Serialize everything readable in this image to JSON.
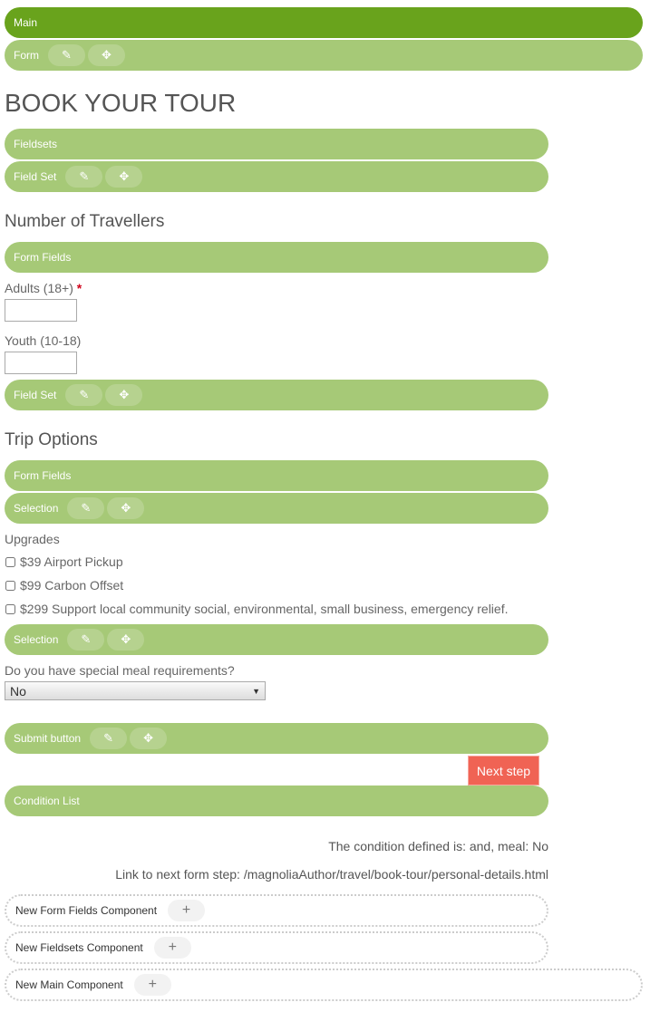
{
  "bars": {
    "main": "Main",
    "form": "Form",
    "fieldsets": "Fieldsets",
    "fieldset1": "Field Set",
    "formfields1": "Form Fields",
    "fieldset2": "Field Set",
    "formfields2": "Form Fields",
    "selection1": "Selection",
    "selection2": "Selection",
    "submit": "Submit button",
    "condition": "Condition List"
  },
  "icons": {
    "edit": "pencil-icon",
    "move": "move-arrows-icon",
    "add": "plus-icon"
  },
  "form": {
    "title": "BOOK YOUR TOUR",
    "travellers_heading": "Number of Travellers",
    "adults_label": "Adults (18+)",
    "required_mark": "*",
    "adults_value": "",
    "youth_label": "Youth (10-18)",
    "youth_value": "",
    "trip_heading": "Trip Options",
    "upgrades_label": "Upgrades",
    "upgrades": [
      {
        "label": "$39 Airport Pickup",
        "checked": false
      },
      {
        "label": "$99 Carbon Offset",
        "checked": false
      },
      {
        "label": "$299 Support local community social, environmental, small business, emergency relief.",
        "checked": false
      }
    ],
    "meal_label": "Do you have special meal requirements?",
    "meal_value": "No",
    "next_button": "Next step"
  },
  "condition_text": "The condition defined is: and, meal: No",
  "link_text": "Link to next form step: /magnoliaAuthor/travel/book-tour/personal-details.html",
  "new_components": [
    "New Form Fields Component",
    "New Fieldsets Component",
    "New Main Component"
  ],
  "colors": {
    "main_bar": "#69a31c",
    "bar": "#a6c977",
    "next_button": "#f06354",
    "required": "#d0021b"
  }
}
